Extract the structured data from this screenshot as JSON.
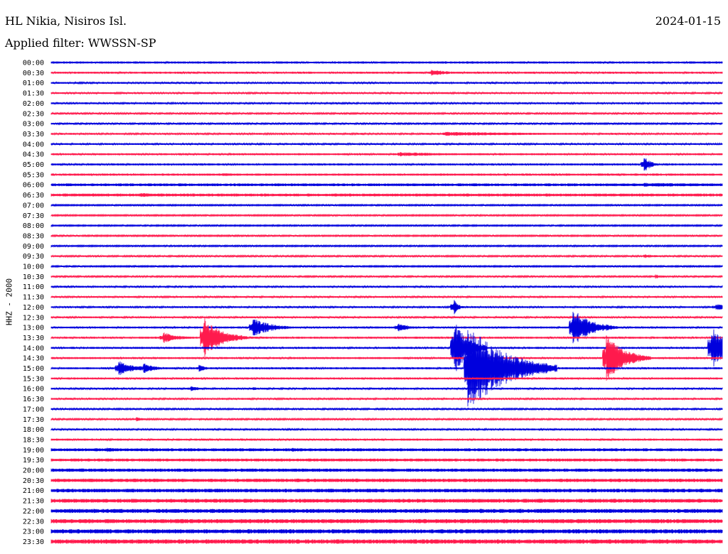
{
  "header": {
    "station": "HL Nikia, Nisiros Isl.",
    "date": "2024-01-15",
    "filter": "Applied filter: WWSSN-SP"
  },
  "channel_label": "HHZ - 2000",
  "colors": {
    "trace_a": "#0000dd",
    "trace_b": "#ff1a4d"
  },
  "chart_data": {
    "type": "line",
    "subtype": "helicorder",
    "rows": [
      "00:00",
      "00:30",
      "01:00",
      "01:30",
      "02:00",
      "02:30",
      "03:00",
      "03:30",
      "04:00",
      "04:30",
      "05:00",
      "05:30",
      "06:00",
      "06:30",
      "07:00",
      "07:30",
      "08:00",
      "08:30",
      "09:00",
      "09:30",
      "10:00",
      "10:30",
      "11:00",
      "11:30",
      "12:00",
      "12:30",
      "13:00",
      "13:30",
      "14:00",
      "14:30",
      "15:00",
      "15:30",
      "16:00",
      "16:30",
      "17:00",
      "17:30",
      "18:00",
      "18:30",
      "19:00",
      "19:30",
      "20:00",
      "20:30",
      "21:00",
      "21:30",
      "22:00",
      "22:30",
      "23:00",
      "23:30"
    ],
    "row_duration_min": 30,
    "noise_level": [
      1.2,
      1.1,
      1.0,
      1.0,
      1.0,
      0.9,
      0.9,
      1.0,
      1.0,
      1.1,
      1.1,
      1.2,
      1.5,
      1.6,
      0.8,
      0.8,
      0.8,
      0.8,
      0.8,
      0.9,
      0.8,
      0.9,
      1.0,
      1.0,
      1.0,
      1.0,
      1.1,
      1.1,
      1.1,
      1.1,
      1.1,
      1.1,
      1.0,
      1.0,
      0.9,
      0.9,
      1.0,
      1.1,
      1.6,
      1.6,
      1.8,
      1.9,
      2.0,
      2.1,
      2.2,
      2.3,
      2.3,
      2.4
    ],
    "events": [
      {
        "row": 1,
        "t_min": 17.0,
        "amp": 5,
        "dur_min": 0.8
      },
      {
        "row": 7,
        "t_min": 17.5,
        "amp": 3,
        "dur_min": 6.0
      },
      {
        "row": 9,
        "t_min": 15.5,
        "amp": 3,
        "dur_min": 3.0
      },
      {
        "row": 10,
        "t_min": 24.5,
        "amp": 2,
        "dur_min": 1.0
      },
      {
        "row": 10,
        "t_min": 26.5,
        "amp": 12,
        "dur_min": 0.3
      },
      {
        "row": 11,
        "t_min": 7.5,
        "amp": 2,
        "dur_min": 3.0
      },
      {
        "row": 12,
        "t_min": 26.5,
        "amp": 3,
        "dur_min": 5.0
      },
      {
        "row": 13,
        "t_min": 1.0,
        "amp": 2,
        "dur_min": 7.0
      },
      {
        "row": 13,
        "t_min": 4.0,
        "amp": 3,
        "dur_min": 1.5
      },
      {
        "row": 19,
        "t_min": 26.5,
        "amp": 3,
        "dur_min": 0.8
      },
      {
        "row": 21,
        "t_min": 27.0,
        "amp": 3,
        "dur_min": 0.5
      },
      {
        "row": 24,
        "t_min": 18.0,
        "amp": 12,
        "dur_min": 0.2
      },
      {
        "row": 24,
        "t_min": 29.7,
        "amp": 5,
        "dur_min": 1.0
      },
      {
        "row": 26,
        "t_min": 9.0,
        "amp": 14,
        "dur_min": 0.8
      },
      {
        "row": 26,
        "t_min": 15.5,
        "amp": 7,
        "dur_min": 0.5
      },
      {
        "row": 26,
        "t_min": 23.3,
        "amp": 28,
        "dur_min": 0.8
      },
      {
        "row": 26,
        "t_min": 24.8,
        "amp": 5,
        "dur_min": 0.4
      },
      {
        "row": 27,
        "t_min": 5.0,
        "amp": 8,
        "dur_min": 0.7
      },
      {
        "row": 27,
        "t_min": 6.8,
        "amp": 30,
        "dur_min": 0.8
      },
      {
        "row": 28,
        "t_min": 18.0,
        "amp": 40,
        "dur_min": 0.6
      },
      {
        "row": 28,
        "t_min": 29.5,
        "amp": 30,
        "dur_min": 1.0
      },
      {
        "row": 29,
        "t_min": 24.8,
        "amp": 35,
        "dur_min": 0.8
      },
      {
        "row": 30,
        "t_min": 3.0,
        "amp": 12,
        "dur_min": 0.6
      },
      {
        "row": 30,
        "t_min": 4.1,
        "amp": 8,
        "dur_min": 0.5
      },
      {
        "row": 30,
        "t_min": 6.6,
        "amp": 5,
        "dur_min": 0.4
      },
      {
        "row": 30,
        "t_min": 18.6,
        "amp": 65,
        "dur_min": 1.6
      },
      {
        "row": 32,
        "t_min": 6.2,
        "amp": 4,
        "dur_min": 0.5
      },
      {
        "row": 32,
        "t_min": 9.0,
        "amp": 3,
        "dur_min": 0.3
      },
      {
        "row": 35,
        "t_min": 3.8,
        "amp": 3,
        "dur_min": 0.5
      },
      {
        "row": 38,
        "t_min": 10.7,
        "amp": 3,
        "dur_min": 1.5
      },
      {
        "row": 38,
        "t_min": 2.5,
        "amp": 3,
        "dur_min": 1.0
      }
    ]
  }
}
